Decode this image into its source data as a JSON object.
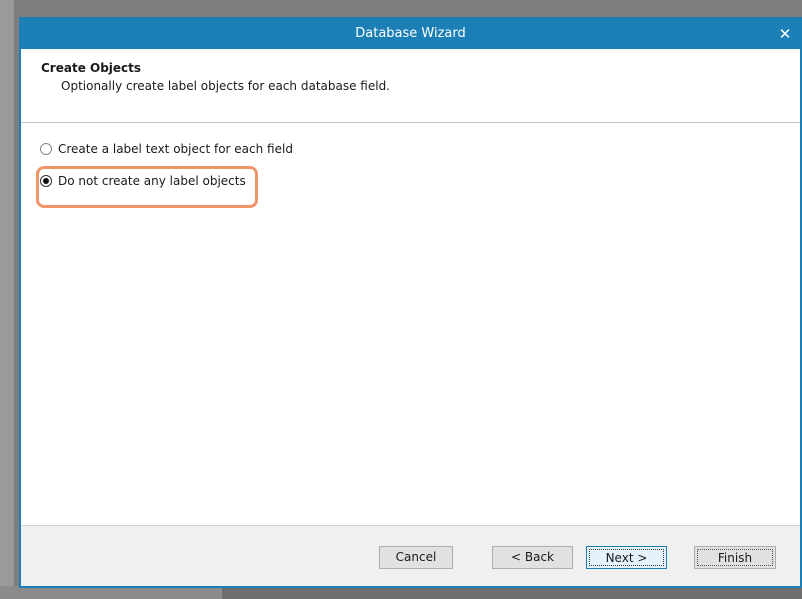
{
  "window": {
    "title": "Database Wizard",
    "close_glyph": "✕",
    "accent_color": "#1c7fb6"
  },
  "header": {
    "title": "Create Objects",
    "subtitle": "Optionally create label objects for each database field."
  },
  "options": [
    {
      "label": "Create a label text object for each field",
      "selected": false
    },
    {
      "label": "Do not create any label objects",
      "selected": true
    }
  ],
  "highlight_color": "#f0956a",
  "buttons": {
    "cancel": "Cancel",
    "back": "< Back",
    "next": "Next >",
    "finish": "Finish"
  }
}
